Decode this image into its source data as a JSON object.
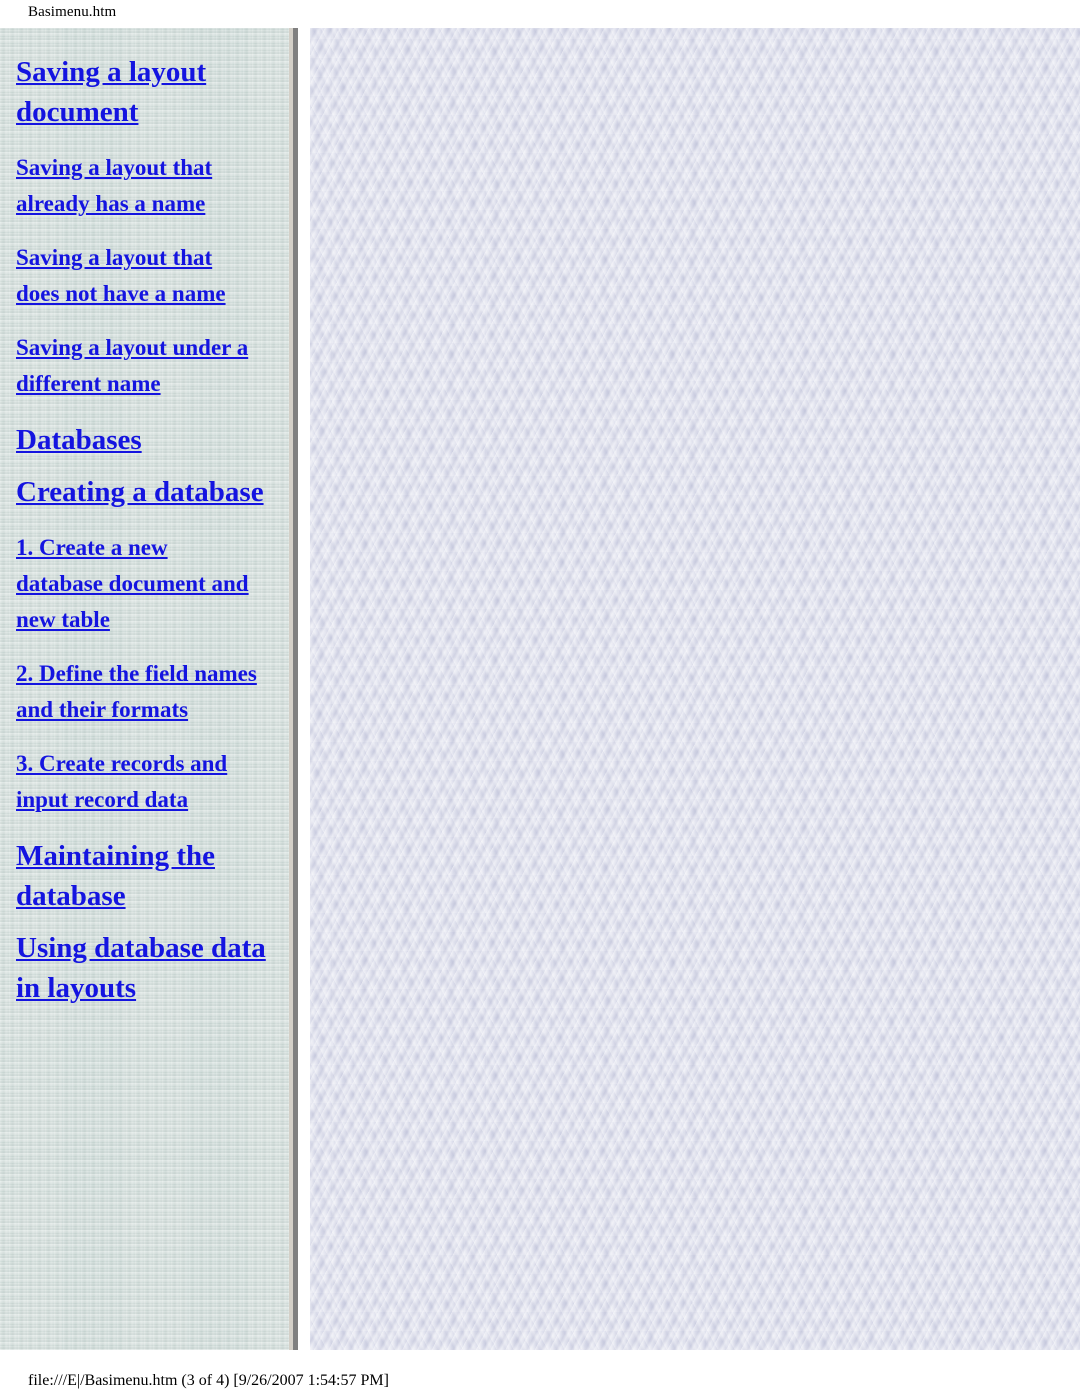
{
  "print_header": {
    "title": "Basimenu.htm"
  },
  "menu_frame": {
    "name": "menu",
    "background_color": "#ccd8d5",
    "link_color": "#1414e0",
    "items": [
      {
        "label": "Saving a layout document",
        "level": 1,
        "space_before": "none"
      },
      {
        "label": "Saving a layout that already has a name",
        "level": 2,
        "space_before": "md"
      },
      {
        "label": "Saving a layout that does not have a name",
        "level": 2,
        "space_before": "md"
      },
      {
        "label": "Saving a layout under a different name",
        "level": 2,
        "space_before": "md"
      },
      {
        "label": "Databases",
        "level": 1,
        "space_before": "md"
      },
      {
        "label": "Creating a database",
        "level": 1,
        "space_before": "sm"
      },
      {
        "label": "1. Create a new database document and new table",
        "level": 2,
        "space_before": "md"
      },
      {
        "label": "2. Define the field names and their formats",
        "level": 2,
        "space_before": "md"
      },
      {
        "label": "3. Create records and input record data",
        "level": 2,
        "space_before": "md"
      },
      {
        "label": "Maintaining the database",
        "level": 1,
        "space_before": "md"
      },
      {
        "label": "Using database data in layouts",
        "level": 1,
        "space_before": "sm"
      }
    ]
  },
  "content_frame": {
    "name": "content",
    "background_color": "#d7d9e9",
    "body_text": ""
  },
  "footer": {
    "text": "file:///E|/Basimenu.htm (3 of 4) [9/26/2007 1:54:57 PM]"
  }
}
